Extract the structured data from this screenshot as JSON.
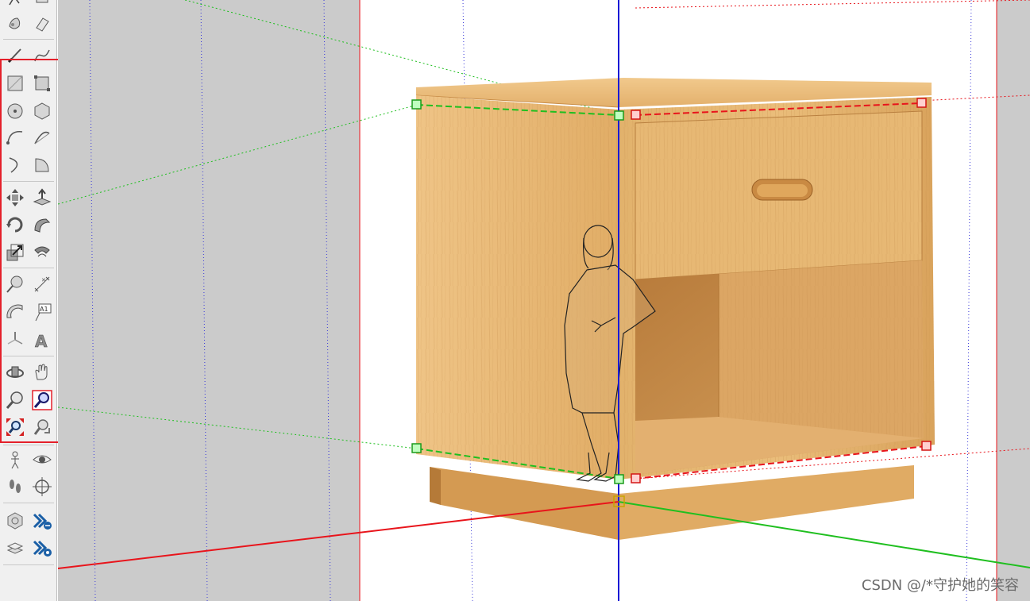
{
  "toolbar": {
    "tools": [
      {
        "name": "lasso-select-tool-icon"
      },
      {
        "name": "eraser-tool-icon"
      },
      {
        "name": "paint-bucket-tool-icon"
      },
      {
        "name": "line-tool-icon"
      },
      {
        "name": "freehand-tool-icon"
      },
      {
        "name": "rectangle-tool-icon"
      },
      {
        "name": "rotated-rectangle-tool-icon"
      },
      {
        "name": "circle-tool-icon"
      },
      {
        "name": "polygon-tool-icon"
      },
      {
        "name": "arc-tool-icon"
      },
      {
        "name": "two-point-arc-tool-icon"
      },
      {
        "name": "three-point-arc-tool-icon"
      },
      {
        "name": "pie-tool-icon"
      },
      {
        "name": "move-tool-icon"
      },
      {
        "name": "push-pull-tool-icon"
      },
      {
        "name": "rotate-tool-icon"
      },
      {
        "name": "follow-me-tool-icon"
      },
      {
        "name": "scale-tool-icon"
      },
      {
        "name": "offset-tool-icon"
      },
      {
        "name": "tape-measure-tool-icon"
      },
      {
        "name": "dimension-tool-icon"
      },
      {
        "name": "protractor-tool-icon"
      },
      {
        "name": "text-tool-icon",
        "label": "A1"
      },
      {
        "name": "axes-tool-icon"
      },
      {
        "name": "3d-text-tool-icon",
        "label": "A"
      },
      {
        "name": "orbit-tool-icon"
      },
      {
        "name": "pan-tool-icon"
      },
      {
        "name": "zoom-tool-icon"
      },
      {
        "name": "zoom-window-tool-icon"
      },
      {
        "name": "zoom-extents-tool-icon"
      },
      {
        "name": "previous-view-tool-icon"
      },
      {
        "name": "position-camera-tool-icon"
      },
      {
        "name": "look-around-tool-icon"
      },
      {
        "name": "walk-tool-icon"
      },
      {
        "name": "section-plane-tool-icon"
      },
      {
        "name": "warehouse-icon"
      },
      {
        "name": "share-component-icon"
      },
      {
        "name": "extension-warehouse-icon"
      },
      {
        "name": "extension-manager-icon"
      }
    ],
    "active_tool": "zoom-window-tool-icon"
  },
  "viewport": {
    "axis_colors": {
      "red": "#e8141b",
      "green": "#1fbf1f",
      "blue": "#1a1ad6"
    },
    "guide_color": "#3a3ad8",
    "background_image": "wooden-nightstand-photo",
    "scale_figure": "standing-woman-silhouette"
  },
  "watermark": "CSDN @/*守护她的笑容"
}
